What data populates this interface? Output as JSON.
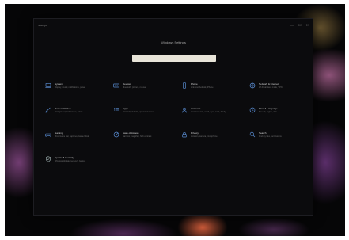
{
  "window": {
    "app_title": "Settings",
    "heading": "Windows Settings",
    "search_value": "",
    "search_placeholder": "",
    "controls": [
      "—",
      "☐",
      "✕"
    ]
  },
  "tiles": [
    {
      "title": "System",
      "desc": "Display, sound, notifications, power",
      "icon": "laptop-icon"
    },
    {
      "title": "Devices",
      "desc": "Bluetooth, printers, mouse",
      "icon": "keyboard-icon"
    },
    {
      "title": "Phone",
      "desc": "Link your Android, iPhone",
      "icon": "phone-icon"
    },
    {
      "title": "Network & Internet",
      "desc": "Wi-Fi, airplane mode, VPN",
      "icon": "globe-icon"
    },
    {
      "title": "Personalization",
      "desc": "Background, lock screen, colors",
      "icon": "brush-icon"
    },
    {
      "title": "Apps",
      "desc": "Uninstall, defaults, optional features",
      "icon": "apps-icon"
    },
    {
      "title": "Accounts",
      "desc": "Your accounts, email, sync, work, family",
      "icon": "person-icon"
    },
    {
      "title": "Time & Language",
      "desc": "Speech, region, date",
      "icon": "clock-icon"
    },
    {
      "title": "Gaming",
      "desc": "Xbox Game Bar, captures, Game Mode",
      "icon": "gamepad-icon"
    },
    {
      "title": "Ease of Access",
      "desc": "Narrator, magnifier, high contrast",
      "icon": "access-icon"
    },
    {
      "title": "Privacy",
      "desc": "Location, camera, microphone",
      "icon": "lock-icon"
    },
    {
      "title": "Search",
      "desc": "Find my files, permissions",
      "icon": "search-icon"
    },
    {
      "title": "Update & Security",
      "desc": "Windows Update, recovery, backup",
      "icon": "shield-icon"
    }
  ],
  "accent": "#5b8fd6"
}
